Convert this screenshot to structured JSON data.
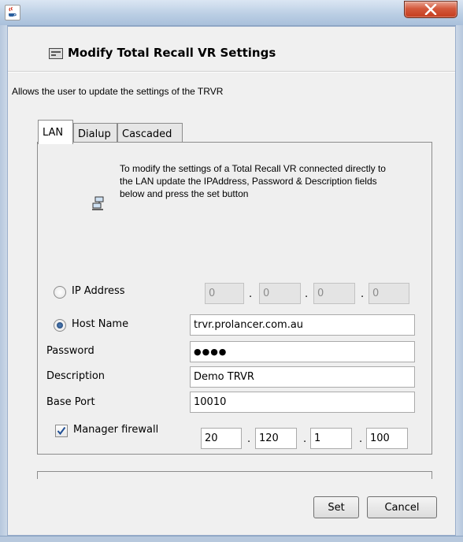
{
  "window": {
    "app_icon": "java-cup-icon",
    "close_icon": "close-icon"
  },
  "header": {
    "title": "Modify Total Recall VR Settings",
    "icon": "settings-panel-icon"
  },
  "description": "Allows the user to update the settings of the TRVR",
  "tabs": [
    {
      "label": "LAN",
      "selected": true
    },
    {
      "label": "Dialup",
      "selected": false
    },
    {
      "label": "Cascaded",
      "selected": false
    }
  ],
  "lan": {
    "info_icon": "network-computers-icon",
    "info_text": "To modify the settings of a Total Recall VR connected directly to the LAN update the IPAddress, Password & Description fields below and press the set button",
    "ip_address": {
      "label": "IP Address",
      "selected": false,
      "octets": [
        "0",
        "0",
        "0",
        "0"
      ],
      "separator": "."
    },
    "host_name": {
      "label": "Host Name",
      "selected": true,
      "value": "trvr.prolancer.com.au"
    },
    "password": {
      "label": "Password",
      "masked_value": "●●●●"
    },
    "description": {
      "label": "Description",
      "value": "Demo TRVR"
    },
    "base_port": {
      "label": "Base Port",
      "value": "10010"
    },
    "manager_firewall": {
      "label": "Manager firewall",
      "checked": true,
      "octets": [
        "20",
        "120",
        "1",
        "100"
      ]
    }
  },
  "buttons": {
    "set": "Set",
    "cancel": "Cancel"
  }
}
